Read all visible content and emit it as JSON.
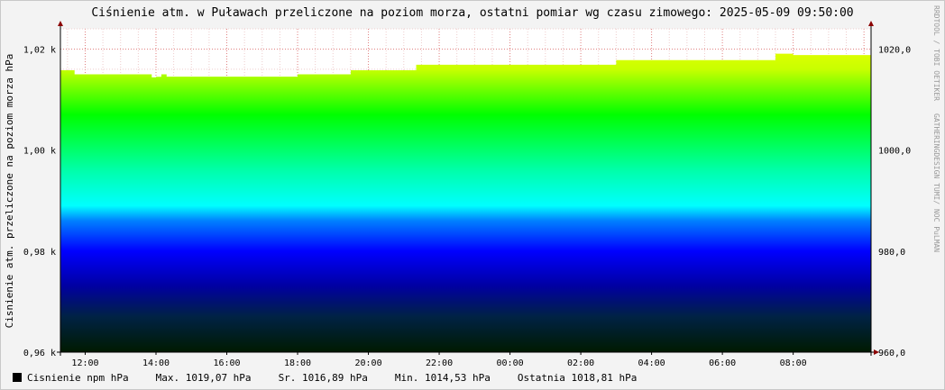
{
  "chart_data": {
    "type": "area",
    "title": "Ciśnienie atm. w Puławach przeliczone na poziom morza, ostatni pomiar wg czasu zimowego: 2025-05-09 09:50:00",
    "ylabel": "Cisnienie atm. przeliczone na poziom morza hPa",
    "watermark": "RRDTOOL / TOBI OETIKER",
    "watermark2": "GATHERINGDESIGN TUMI/ NOC PuLMAN",
    "x_ticks": [
      "12:00",
      "14:00",
      "16:00",
      "18:00",
      "20:00",
      "22:00",
      "00:00",
      "02:00",
      "04:00",
      "06:00",
      "08:00"
    ],
    "x_tick_hours": [
      12,
      14,
      16,
      18,
      20,
      22,
      24,
      26,
      28,
      30,
      32
    ],
    "x_range_hours": [
      11.3,
      34.2
    ],
    "ylim": [
      960,
      1024
    ],
    "y_ticks_left": [
      {
        "value": 1020,
        "label": "1,02 k"
      },
      {
        "value": 1000,
        "label": "1,00 k"
      },
      {
        "value": 980,
        "label": "0,98 k"
      },
      {
        "value": 960,
        "label": "0,96 k"
      }
    ],
    "y_ticks_right": [
      {
        "value": 1020,
        "label": "1020,0"
      },
      {
        "value": 1000,
        "label": "1000,0"
      },
      {
        "value": 980,
        "label": "980,0"
      },
      {
        "value": 960,
        "label": "960,0"
      }
    ],
    "series": [
      {
        "name": "Cisnienie npm hPa",
        "steps": [
          {
            "from": 11.3,
            "to": 11.7,
            "value": 1015.8
          },
          {
            "from": 11.7,
            "to": 13.88,
            "value": 1015.0
          },
          {
            "from": 13.88,
            "to": 14.0,
            "value": 1014.4
          },
          {
            "from": 14.0,
            "to": 14.15,
            "value": 1014.5
          },
          {
            "from": 14.15,
            "to": 14.3,
            "value": 1015.0
          },
          {
            "from": 14.3,
            "to": 18.0,
            "value": 1014.53
          },
          {
            "from": 18.0,
            "to": 19.5,
            "value": 1015.0
          },
          {
            "from": 19.5,
            "to": 21.35,
            "value": 1015.8
          },
          {
            "from": 21.35,
            "to": 27.0,
            "value": 1016.9
          },
          {
            "from": 27.0,
            "to": 29.0,
            "value": 1017.8
          },
          {
            "from": 29.0,
            "to": 31.5,
            "value": 1017.8
          },
          {
            "from": 31.5,
            "to": 32.0,
            "value": 1019.07
          },
          {
            "from": 32.0,
            "to": 34.2,
            "value": 1018.81
          }
        ]
      }
    ],
    "gradient_stops": [
      {
        "value": 1024,
        "color": "#ffff00"
      },
      {
        "value": 1016,
        "color": "#c8ff00"
      },
      {
        "value": 1007,
        "color": "#00ff00"
      },
      {
        "value": 996,
        "color": "#00ffaa"
      },
      {
        "value": 989,
        "color": "#00ffff"
      },
      {
        "value": 986,
        "color": "#0080ff"
      },
      {
        "value": 980,
        "color": "#0000ff"
      },
      {
        "value": 973,
        "color": "#0000a0"
      },
      {
        "value": 967,
        "color": "#002244"
      },
      {
        "value": 960,
        "color": "#001a00"
      }
    ]
  },
  "legend": {
    "series_label": "Cisnienie npm hPa",
    "max": "Max. 1019,07 hPa",
    "avg": "Sr. 1016,89 hPa",
    "min": "Min. 1014,53 hPa",
    "last": "Ostatnia 1018,81 hPa"
  }
}
